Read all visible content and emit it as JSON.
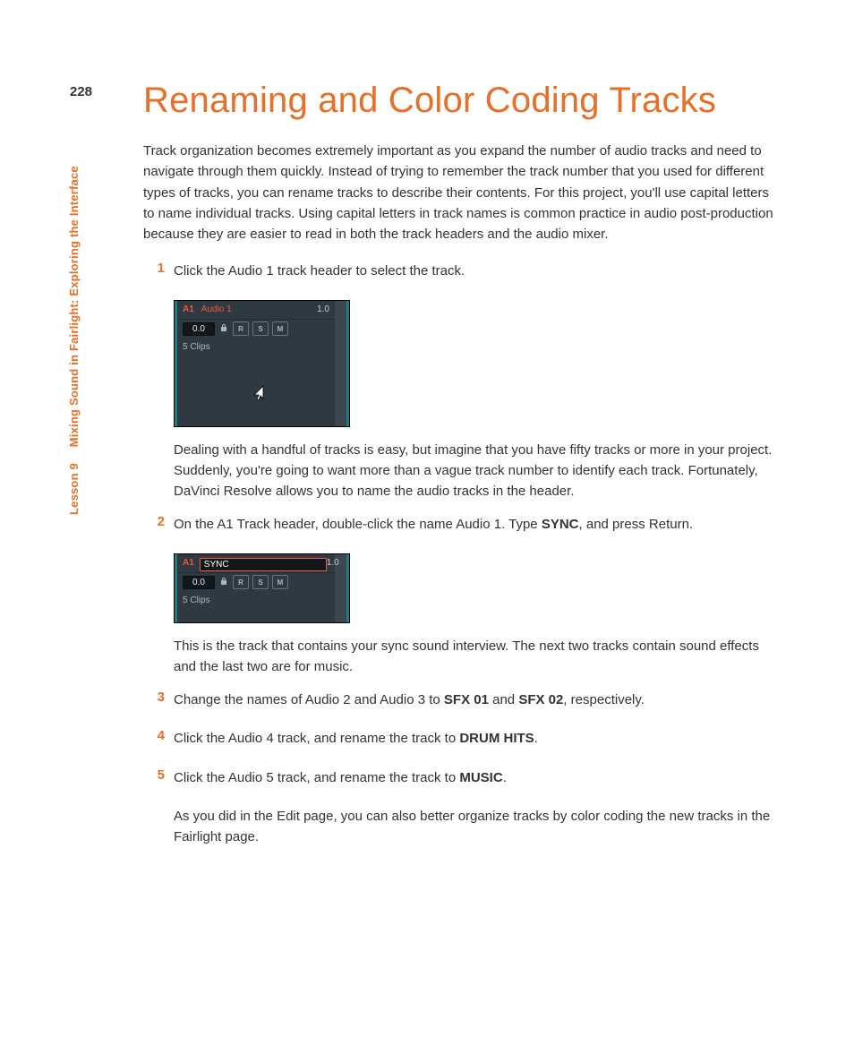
{
  "page_number": "228",
  "side": {
    "lesson": "Lesson 9",
    "title": "Mixing Sound in Fairlight: Exploring the Interface"
  },
  "heading": "Renaming and Color Coding Tracks",
  "intro": "Track organization becomes extremely important as you expand the number of audio tracks and need to navigate through them quickly. Instead of trying to remember the track number that you used for different types of tracks, you can rename tracks to describe their contents. For this project, you'll use capital letters to name individual tracks. Using capital letters in track names is common practice in audio post-production because they are easier to read in both the track headers and the audio mixer.",
  "steps": {
    "s1": {
      "num": "1",
      "text": "Click the Audio 1 track header to select the track."
    },
    "s2": {
      "num": "2",
      "prefix": "On the A1 Track header, double-click the name Audio 1. Type ",
      "bold": "SYNC",
      "suffix": ", and press Return."
    },
    "s3": {
      "num": "3",
      "prefix": "Change the names of Audio 2 and Audio 3 to ",
      "bold1": "SFX 01",
      "mid": " and ",
      "bold2": "SFX 02",
      "suffix": ", respectively."
    },
    "s4": {
      "num": "4",
      "prefix": "Click the Audio 4 track, and rename the track to ",
      "bold": "DRUM HITS",
      "suffix": "."
    },
    "s5": {
      "num": "5",
      "prefix": "Click the Audio 5 track, and rename the track to ",
      "bold": "MUSIC",
      "suffix": "."
    }
  },
  "after1": "Dealing with a handful of tracks is easy, but imagine that you have fifty tracks or more in your project. Suddenly, you're going to want more than a vague track number to identify each track. Fortunately, DaVinci Resolve allows you to name the audio tracks in the header.",
  "after2": "This is the track that contains your sync sound interview. The next two tracks contain sound effects and the last two are for music.",
  "after5": "As you did in the Edit page, you can also better organize tracks by color coding the new tracks in the Fairlight page.",
  "shot1": {
    "a1": "A1",
    "name": "Audio 1",
    "meter": "1.0",
    "vol": "0.0",
    "r": "R",
    "s": "S",
    "m": "M",
    "clips": "5 Clips"
  },
  "shot2": {
    "a1": "A1",
    "edit": "SYNC",
    "meter": "1.0",
    "vol": "0.0",
    "r": "R",
    "s": "S",
    "m": "M",
    "clips": "5 Clips"
  }
}
